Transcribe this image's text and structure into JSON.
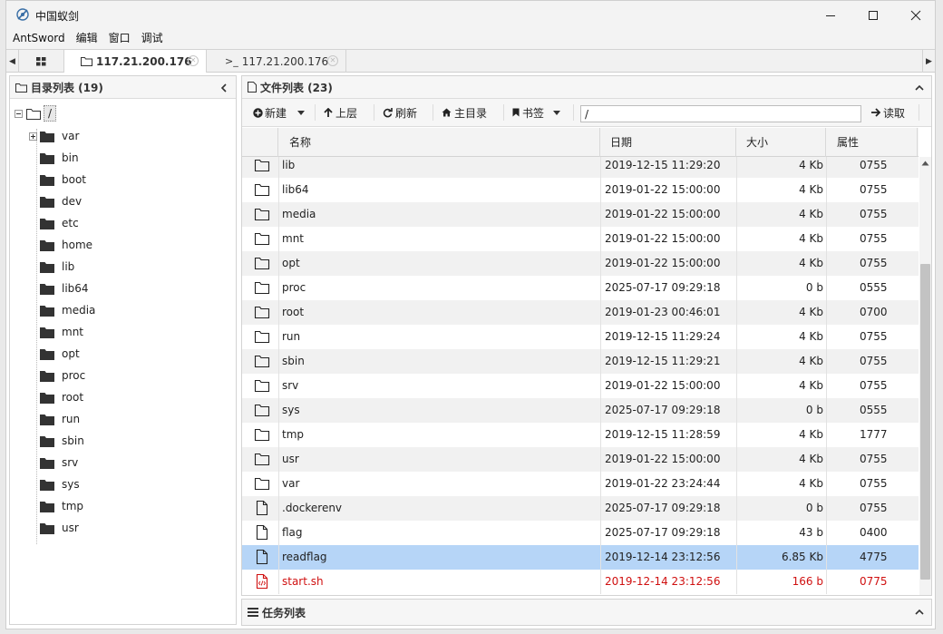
{
  "window": {
    "title": "中国蚁剑"
  },
  "menu": [
    "AntSword",
    "编辑",
    "窗口",
    "调试"
  ],
  "tabs": {
    "home_icon": "grid-icon",
    "file_tab": "117.21.200.176",
    "terminal_tab": "117.21.200.176",
    "terminal_prefix": ">_"
  },
  "left_panel": {
    "title": "目录列表 (19)",
    "root": "/",
    "dirs": [
      "var",
      "bin",
      "boot",
      "dev",
      "etc",
      "home",
      "lib",
      "lib64",
      "media",
      "mnt",
      "opt",
      "proc",
      "root",
      "run",
      "sbin",
      "srv",
      "sys",
      "tmp",
      "usr"
    ]
  },
  "right_panel": {
    "title": "文件列表 (23)",
    "toolbar": {
      "new": "新建",
      "up": "上层",
      "refresh": "刷新",
      "home": "主目录",
      "bookmark": "书签",
      "path": "/",
      "read": "读取"
    },
    "columns": {
      "name": "名称",
      "date": "日期",
      "size": "大小",
      "attr": "属性"
    },
    "files": [
      {
        "name": "lib",
        "date": "2019-12-15 11:29:20",
        "size": "4 Kb",
        "attr": "0755",
        "type": "folder"
      },
      {
        "name": "lib64",
        "date": "2019-01-22 15:00:00",
        "size": "4 Kb",
        "attr": "0755",
        "type": "folder"
      },
      {
        "name": "media",
        "date": "2019-01-22 15:00:00",
        "size": "4 Kb",
        "attr": "0755",
        "type": "folder"
      },
      {
        "name": "mnt",
        "date": "2019-01-22 15:00:00",
        "size": "4 Kb",
        "attr": "0755",
        "type": "folder"
      },
      {
        "name": "opt",
        "date": "2019-01-22 15:00:00",
        "size": "4 Kb",
        "attr": "0755",
        "type": "folder"
      },
      {
        "name": "proc",
        "date": "2025-07-17 09:29:18",
        "size": "0 b",
        "attr": "0555",
        "type": "folder"
      },
      {
        "name": "root",
        "date": "2019-01-23 00:46:01",
        "size": "4 Kb",
        "attr": "0700",
        "type": "folder"
      },
      {
        "name": "run",
        "date": "2019-12-15 11:29:24",
        "size": "4 Kb",
        "attr": "0755",
        "type": "folder"
      },
      {
        "name": "sbin",
        "date": "2019-12-15 11:29:21",
        "size": "4 Kb",
        "attr": "0755",
        "type": "folder"
      },
      {
        "name": "srv",
        "date": "2019-01-22 15:00:00",
        "size": "4 Kb",
        "attr": "0755",
        "type": "folder"
      },
      {
        "name": "sys",
        "date": "2025-07-17 09:29:18",
        "size": "0 b",
        "attr": "0555",
        "type": "folder"
      },
      {
        "name": "tmp",
        "date": "2019-12-15 11:28:59",
        "size": "4 Kb",
        "attr": "1777",
        "type": "folder"
      },
      {
        "name": "usr",
        "date": "2019-01-22 15:00:00",
        "size": "4 Kb",
        "attr": "0755",
        "type": "folder"
      },
      {
        "name": "var",
        "date": "2019-01-22 23:24:44",
        "size": "4 Kb",
        "attr": "0755",
        "type": "folder"
      },
      {
        "name": ".dockerenv",
        "date": "2025-07-17 09:29:18",
        "size": "0 b",
        "attr": "0755",
        "type": "file"
      },
      {
        "name": "flag",
        "date": "2025-07-17 09:29:18",
        "size": "43 b",
        "attr": "0400",
        "type": "file"
      },
      {
        "name": "readflag",
        "date": "2019-12-14 23:12:56",
        "size": "6.85 Kb",
        "attr": "4775",
        "type": "file",
        "selected": true
      },
      {
        "name": "start.sh",
        "date": "2019-12-14 23:12:56",
        "size": "166 b",
        "attr": "0775",
        "type": "script",
        "highlight": true
      }
    ]
  },
  "task_panel": {
    "title": "任务列表"
  },
  "colors": {
    "selected_row": "#b6d5f7",
    "script_text": "#d01010",
    "scrollbar_thumb": "#c3c3c3"
  }
}
